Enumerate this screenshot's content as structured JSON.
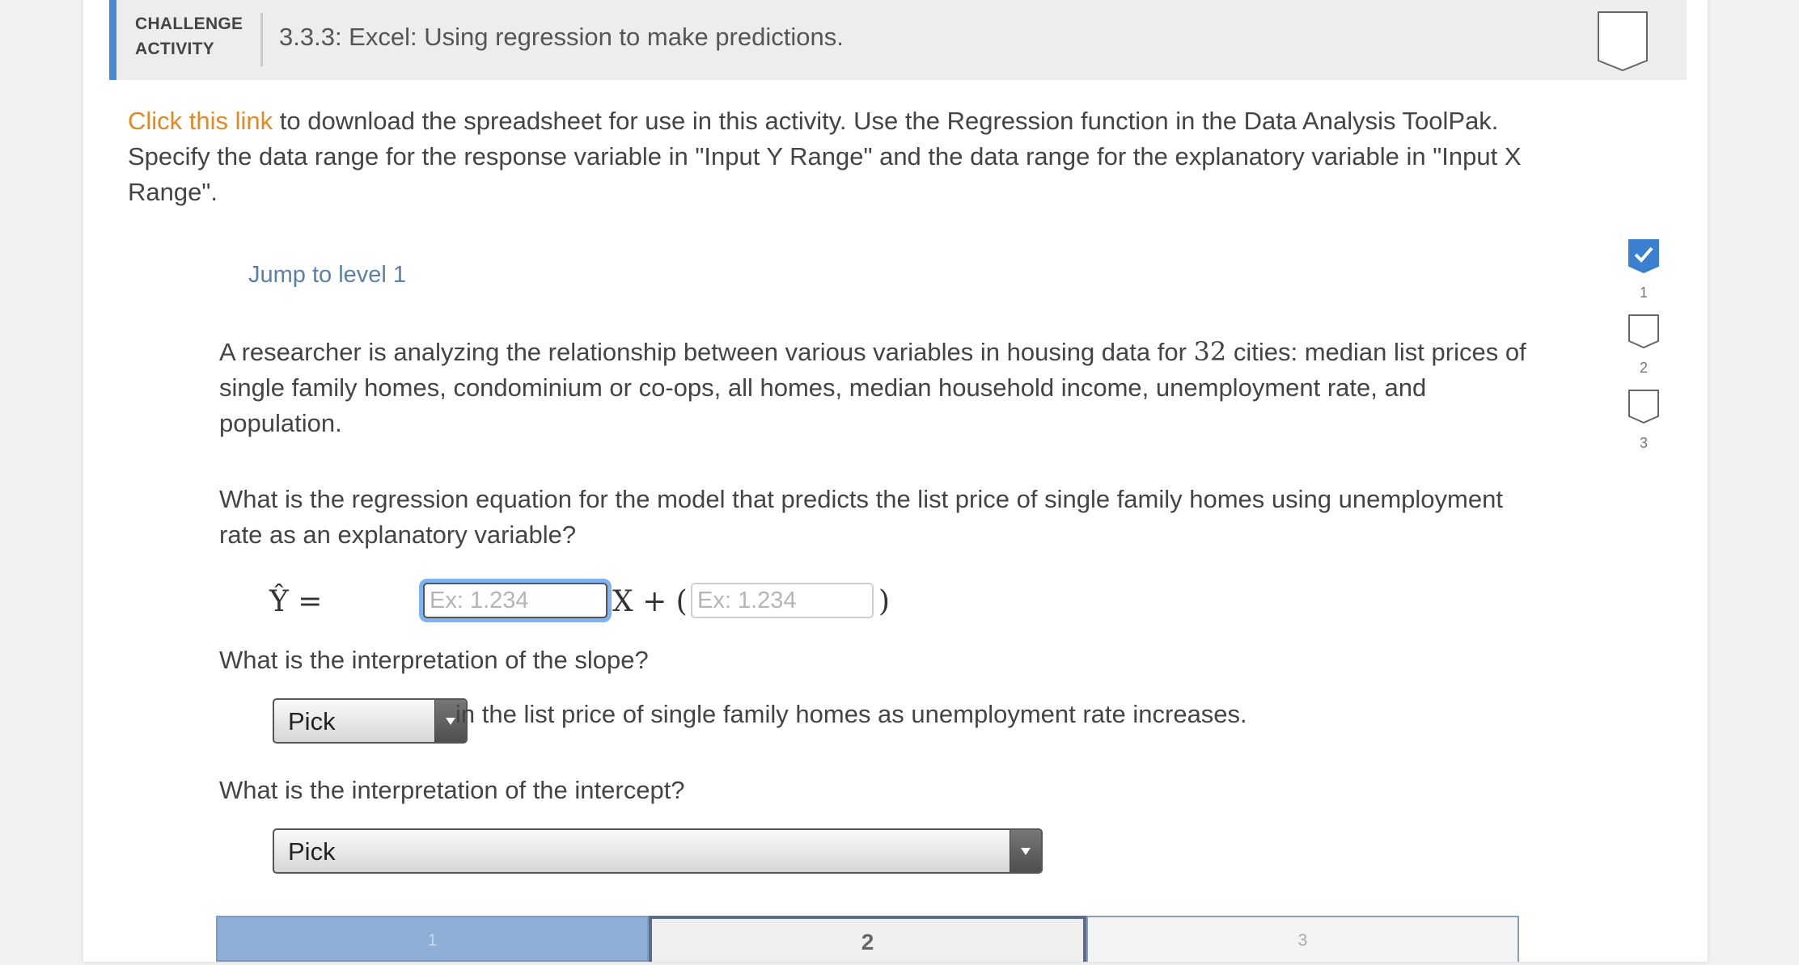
{
  "header": {
    "badge_line1": "CHALLENGE",
    "badge_line2": "ACTIVITY",
    "title": "3.3.3: Excel: Using regression to make predictions."
  },
  "intro": {
    "link_text": "Click this link",
    "text": " to download the spreadsheet for use in this activity. Use the Regression function in the Data Analysis ToolPak. Specify the data range for the response variable in \"Input Y Range\" and the data range for the explanatory variable in \"Input X Range\"."
  },
  "jump_link": "Jump to level 1",
  "levels": [
    {
      "number": "1",
      "completed": true
    },
    {
      "number": "2",
      "completed": false
    },
    {
      "number": "3",
      "completed": false
    }
  ],
  "problem": {
    "text_before": "A researcher is analyzing the relationship between various variables in housing data for ",
    "city_count": "32",
    "text_after": " cities: median list prices of single family homes, condominium or co-ops, all homes, median household income, unemployment rate, and population."
  },
  "question1": "What is the regression equation for the model that predicts the list price of single family homes using unemployment rate as an explanatory variable?",
  "equation": {
    "lhs": "Ŷ =",
    "x_term": "X + (",
    "close_paren": ")",
    "slope_placeholder": "Ex: 1.234",
    "intercept_placeholder": "Ex: 1.234",
    "slope_value": "",
    "intercept_value": ""
  },
  "question2": "What is the interpretation of the slope?",
  "slope_select": {
    "selected": "Pick"
  },
  "slope_suffix": "in the list price of single family homes as unemployment rate increases.",
  "question3": "What is the interpretation of the intercept?",
  "intercept_select": {
    "selected": "Pick"
  },
  "tabs": [
    {
      "label": "1",
      "state": "completed"
    },
    {
      "label": "2",
      "state": "active"
    },
    {
      "label": "3",
      "state": "inactive"
    }
  ],
  "colors": {
    "accent": "#4a8ad4",
    "link": "#e08a25",
    "jump_link": "#5b7fa6",
    "focus_ring": "#7eb2f2",
    "tab_completed": "#8eaed6"
  }
}
